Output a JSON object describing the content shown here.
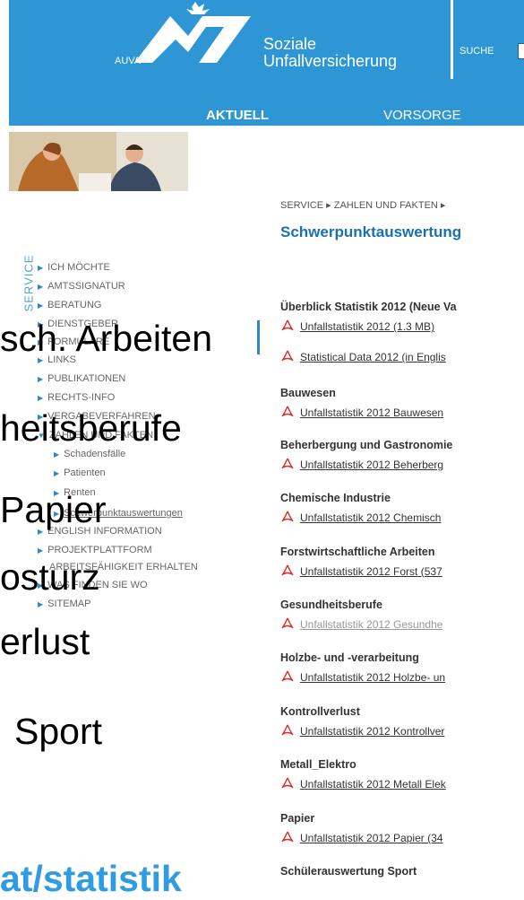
{
  "header": {
    "logo_text": "AUVA",
    "brand_line1": "Soziale",
    "brand_line2": "Unfallversicherung",
    "search_label": "SUCHE",
    "nav": [
      "AKTUELL",
      "VORSORGE"
    ]
  },
  "breadcrumb": "SERVICE  ▸  ZAHLEN UND FAKTEN  ▸",
  "page_title": "Schwerpunktauswertung",
  "sidebar": {
    "vertical_label": "SERVICE",
    "items": [
      "ICH MÖCHTE",
      "AMTSSIGNATUR",
      "BERATUNG",
      "DIENSTGEBER",
      "FORMULARE",
      "LINKS",
      "PUBLIKATIONEN",
      "RECHTS-INFO",
      "VERGABEVERFAHREN",
      "ZAHLEN UND FAKTEN",
      "Schadensfälle",
      "Patienten",
      "Renten",
      "Schwerpunktauswertungen",
      "ENGLISH INFORMATION",
      "PROJEKTPLATTFORM",
      "ARBEITSFÄHIGKEIT ERHALTEN",
      "WAS FINDEN SIE WO",
      "SITEMAP"
    ]
  },
  "overlay": {
    "lines": [
      "sch. Arbeiten",
      "heitsberufe",
      "Papier",
      "osturz",
      "erlust",
      "Sport"
    ],
    "url": "at/statistik"
  },
  "content": {
    "sections": [
      {
        "heading": "Überblick Statistik 2012 (Neue Va",
        "links": [
          "Unfallstatistik 2012 (1.3 MB)",
          "Statistical Data 2012 (in Englis"
        ]
      },
      {
        "heading": "Bauwesen",
        "links": [
          "Unfallstatistik 2012 Bauwesen"
        ]
      },
      {
        "heading": "Beherbergung und Gastronomie",
        "links": [
          "Unfallstatistik 2012 Beherberg"
        ]
      },
      {
        "heading": "Chemische Industrie",
        "links": [
          "Unfallstatistik 2012 Chemisch"
        ]
      },
      {
        "heading": "Forstwirtschaftliche Arbeiten",
        "links": [
          "Unfallstatistik 2012 Forst (537"
        ]
      },
      {
        "heading": "Gesundheitsberufe",
        "links": [
          "Unfallstatistik 2012 Gesundhe"
        ]
      },
      {
        "heading": "Holzbe- und -verarbeitung",
        "links": [
          "Unfallstatistik 2012 Holzbe- un"
        ]
      },
      {
        "heading": "Kontrollverlust",
        "links": [
          "Unfallstatistik 2012 Kontrollver"
        ]
      },
      {
        "heading": "Metall_Elektro",
        "links": [
          "Unfallstatistik 2012 Metall Elek"
        ]
      },
      {
        "heading": "Papier",
        "links": [
          "Unfallstatistik 2012 Papier (34"
        ]
      },
      {
        "heading": "Schülerauswertung Sport",
        "links": []
      }
    ]
  },
  "colors": {
    "header_blue": "#2f96d6",
    "title_blue": "#1b6fb3",
    "overlay_url": "#2f9be0"
  }
}
